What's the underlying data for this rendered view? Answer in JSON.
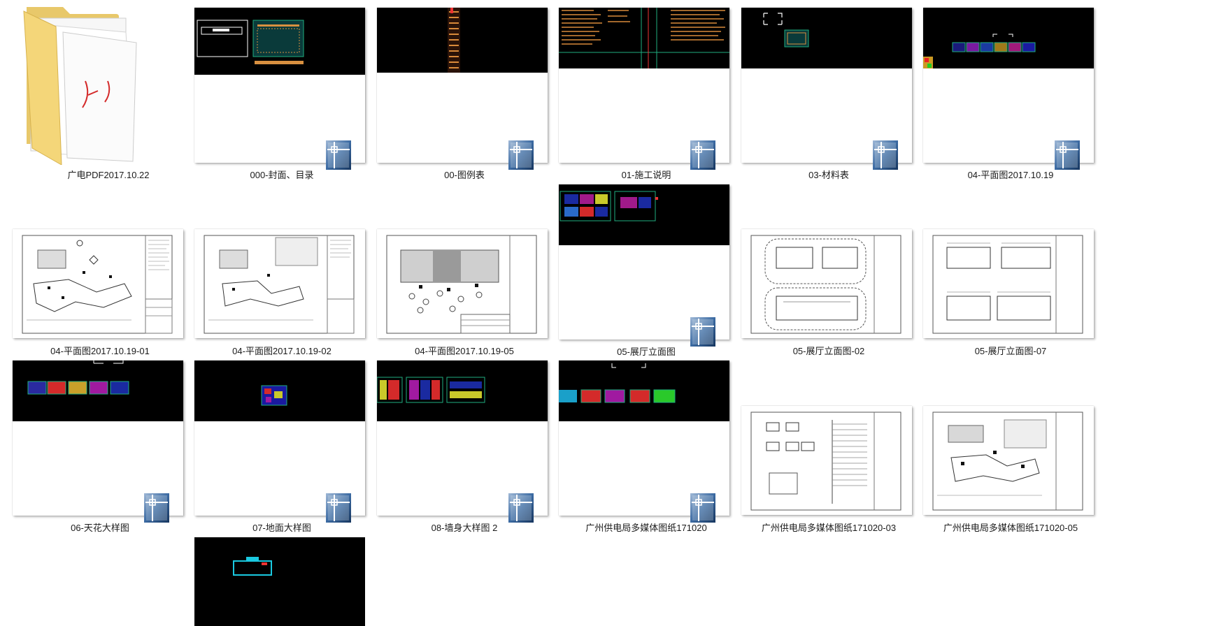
{
  "items": [
    {
      "label": "广电PDF2017.10.22",
      "type": "folder"
    },
    {
      "label": "000-封面、目录",
      "type": "dark"
    },
    {
      "label": "00-图例表",
      "type": "dark"
    },
    {
      "label": "01-施工说明",
      "type": "dark"
    },
    {
      "label": "03-材料表",
      "type": "dark"
    },
    {
      "label": "04-平面图2017.10.19",
      "type": "dark"
    },
    {
      "label": "04-平面图2017.10.19-01",
      "type": "plan"
    },
    {
      "label": "04-平面图2017.10.19-02",
      "type": "plan"
    },
    {
      "label": "04-平面图2017.10.19-05",
      "type": "plan"
    },
    {
      "label": "05-展厅立面图",
      "type": "dark"
    },
    {
      "label": "05-展厅立面图-02",
      "type": "plan"
    },
    {
      "label": "05-展厅立面图-07",
      "type": "plan"
    },
    {
      "label": "06-天花大样图",
      "type": "dark"
    },
    {
      "label": "07-地面大样图",
      "type": "dark"
    },
    {
      "label": "08-墙身大样图 2",
      "type": "dark"
    },
    {
      "label": "广州供电局多媒体图纸171020",
      "type": "dark"
    },
    {
      "label": "广州供电局多媒体图纸171020-03",
      "type": "plan"
    },
    {
      "label": "广州供电局多媒体图纸171020-05",
      "type": "plan"
    },
    {
      "label": "",
      "type": "dark"
    }
  ]
}
